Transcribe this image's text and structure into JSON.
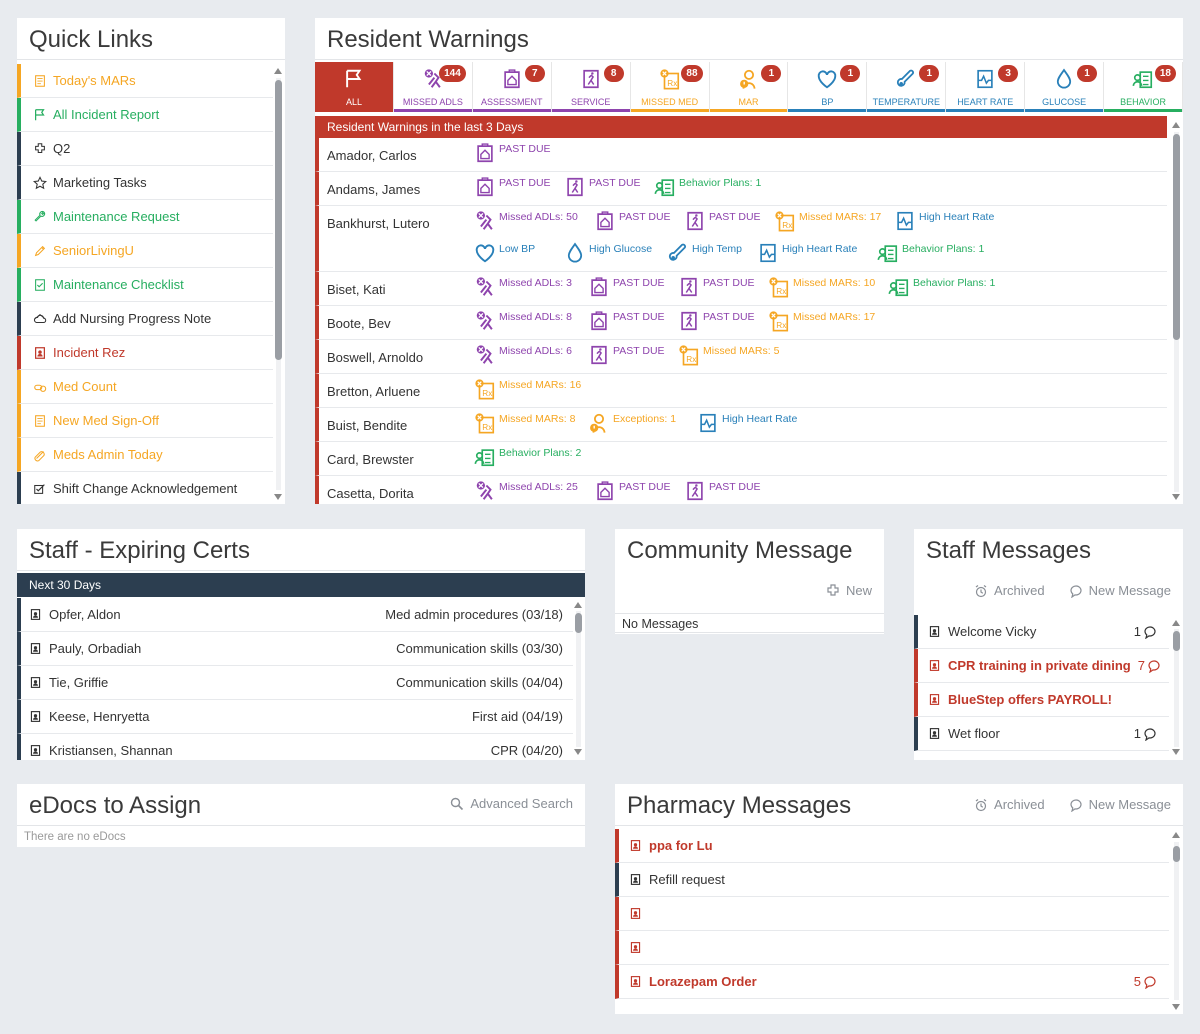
{
  "quick_links": {
    "title": "Quick Links",
    "items": [
      {
        "label": "Today's MARs",
        "icon": "mar-icon",
        "color": "#f5a623"
      },
      {
        "label": "All Incident Report",
        "icon": "flag-icon",
        "color": "#27ae60"
      },
      {
        "label": "Q2",
        "icon": "puzzle-icon",
        "color": "#333333"
      },
      {
        "label": "Marketing Tasks",
        "icon": "star-icon",
        "color": "#333333"
      },
      {
        "label": "Maintenance Request",
        "icon": "wrench-icon",
        "color": "#27ae60"
      },
      {
        "label": "SeniorLivingU",
        "icon": "pencil-icon",
        "color": "#f5a623"
      },
      {
        "label": "Maintenance Checklist",
        "icon": "checklist-icon",
        "color": "#27ae60"
      },
      {
        "label": "Add Nursing Progress Note",
        "icon": "cloud-icon",
        "color": "#333333"
      },
      {
        "label": "Incident Rez",
        "icon": "person-card-icon",
        "color": "#c0392b"
      },
      {
        "label": "Med Count",
        "icon": "pills-icon",
        "color": "#f5a623"
      },
      {
        "label": "New Med Sign-Off",
        "icon": "mar-icon",
        "color": "#f5a623"
      },
      {
        "label": "Meds Admin Today",
        "icon": "pill-icon",
        "color": "#f5a623"
      },
      {
        "label": "Shift Change Acknowledgement",
        "icon": "checkbox-edit-icon",
        "color": "#333333"
      }
    ]
  },
  "resident_warnings": {
    "title": "Resident Warnings",
    "banner": "Resident Warnings in the last 3 Days",
    "tabs": [
      {
        "label": "ALL",
        "badge": "",
        "color": "#c0392b",
        "icon": "flag-icon"
      },
      {
        "label": "MISSED ADLS",
        "badge": "144",
        "color": "#8e44ad",
        "icon": "missed-adl-icon"
      },
      {
        "label": "ASSESSMENT",
        "badge": "7",
        "color": "#8e44ad",
        "icon": "assessment-icon"
      },
      {
        "label": "SERVICE",
        "badge": "8",
        "color": "#8e44ad",
        "icon": "service-icon"
      },
      {
        "label": "MISSED MED",
        "badge": "88",
        "color": "#f5a623",
        "icon": "missed-med-icon"
      },
      {
        "label": "MAR",
        "badge": "1",
        "color": "#f5a623",
        "icon": "mar-exception-icon"
      },
      {
        "label": "BP",
        "badge": "1",
        "color": "#2980b9",
        "icon": "heart-icon"
      },
      {
        "label": "TEMPERATURE",
        "badge": "1",
        "color": "#2980b9",
        "icon": "thermometer-icon"
      },
      {
        "label": "HEART RATE",
        "badge": "3",
        "color": "#2980b9",
        "icon": "heart-rate-icon"
      },
      {
        "label": "GLUCOSE",
        "badge": "1",
        "color": "#2980b9",
        "icon": "drop-icon"
      },
      {
        "label": "BEHAVIOR",
        "badge": "18",
        "color": "#27ae60",
        "icon": "behavior-icon"
      }
    ],
    "rows": [
      {
        "name": "Amador, Carlos",
        "lines": [
          [
            {
              "t": "PAST DUE",
              "k": "assess"
            }
          ]
        ]
      },
      {
        "name": "Andams, James",
        "lines": [
          [
            {
              "t": "PAST DUE",
              "k": "assess"
            },
            {
              "t": "PAST DUE",
              "k": "service"
            },
            {
              "t": "Behavior Plans: 1",
              "k": "behavior"
            }
          ]
        ]
      },
      {
        "name": "Bankhurst, Lutero",
        "lines": [
          [
            {
              "t": "Missed ADLs: 50",
              "k": "adl"
            },
            {
              "t": "PAST DUE",
              "k": "assess"
            },
            {
              "t": "PAST DUE",
              "k": "service"
            },
            {
              "t": "Missed MARs: 17",
              "k": "med"
            },
            {
              "t": "High Heart Rate",
              "k": "hr"
            }
          ],
          [
            {
              "t": "Low BP",
              "k": "bp"
            },
            {
              "t": "High Glucose",
              "k": "glucose"
            },
            {
              "t": "High Temp",
              "k": "temp"
            },
            {
              "t": "High Heart Rate",
              "k": "hr"
            },
            {
              "t": "Behavior Plans: 1",
              "k": "behavior"
            }
          ]
        ]
      },
      {
        "name": "Biset, Kati",
        "lines": [
          [
            {
              "t": "Missed ADLs: 3",
              "k": "adl"
            },
            {
              "t": "PAST DUE",
              "k": "assess"
            },
            {
              "t": "PAST DUE",
              "k": "service"
            },
            {
              "t": "Missed MARs: 10",
              "k": "med"
            },
            {
              "t": "Behavior Plans: 1",
              "k": "behavior"
            }
          ]
        ]
      },
      {
        "name": "Boote, Bev",
        "lines": [
          [
            {
              "t": "Missed ADLs: 8",
              "k": "adl"
            },
            {
              "t": "PAST DUE",
              "k": "assess"
            },
            {
              "t": "PAST DUE",
              "k": "service"
            },
            {
              "t": "Missed MARs: 17",
              "k": "med"
            }
          ]
        ]
      },
      {
        "name": "Boswell, Arnoldo",
        "lines": [
          [
            {
              "t": "Missed ADLs: 6",
              "k": "adl"
            },
            {
              "t": "PAST DUE",
              "k": "service"
            },
            {
              "t": "Missed MARs: 5",
              "k": "med"
            }
          ]
        ]
      },
      {
        "name": "Bretton, Arluene",
        "lines": [
          [
            {
              "t": "Missed MARs: 16",
              "k": "med"
            }
          ]
        ]
      },
      {
        "name": "Buist, Bendite",
        "lines": [
          [
            {
              "t": "Missed MARs: 8",
              "k": "med"
            },
            {
              "t": "Exceptions: 1",
              "k": "exception"
            },
            {
              "t": "High Heart Rate",
              "k": "hr"
            }
          ]
        ]
      },
      {
        "name": "Card, Brewster",
        "lines": [
          [
            {
              "t": "Behavior Plans: 2",
              "k": "behavior"
            }
          ]
        ]
      },
      {
        "name": "Casetta, Dorita",
        "lines": [
          [
            {
              "t": "Missed ADLs: 25",
              "k": "adl"
            },
            {
              "t": "PAST DUE",
              "k": "assess"
            },
            {
              "t": "PAST DUE",
              "k": "service"
            }
          ]
        ]
      }
    ]
  },
  "certs": {
    "title": "Staff - Expiring Certs",
    "header": "Next 30 Days",
    "rows": [
      {
        "name": "Opfer, Aldon",
        "cert": "Med admin procedures (03/18)"
      },
      {
        "name": "Pauly, Orbadiah",
        "cert": "Communication skills (03/30)"
      },
      {
        "name": "Tie, Griffie",
        "cert": "Communication skills (04/04)"
      },
      {
        "name": "Keese, Henryetta",
        "cert": "First aid (04/19)"
      },
      {
        "name": "Kristiansen, Shannan",
        "cert": "CPR (04/20)"
      }
    ]
  },
  "community": {
    "title": "Community Message",
    "new_label": "New",
    "empty": "No Messages"
  },
  "staff_messages": {
    "title": "Staff Messages",
    "archived_label": "Archived",
    "new_message_label": "New Message",
    "rows": [
      {
        "text": "Welcome Vicky",
        "count": "1",
        "color": "#2c3e50",
        "text_color": "#333333",
        "bold": false
      },
      {
        "text": "CPR training in private dining",
        "count": "7",
        "color": "#c0392b",
        "text_color": "#c0392b",
        "bold": true
      },
      {
        "text": "BlueStep offers PAYROLL!",
        "count": "",
        "color": "#c0392b",
        "text_color": "#c0392b",
        "bold": true
      },
      {
        "text": "Wet floor",
        "count": "1",
        "color": "#2c3e50",
        "text_color": "#333333",
        "bold": false
      }
    ]
  },
  "edocs": {
    "title": "eDocs to Assign",
    "search_label": "Advanced Search",
    "empty": "There are no eDocs"
  },
  "pharmacy": {
    "title": "Pharmacy Messages",
    "archived_label": "Archived",
    "new_message_label": "New Message",
    "rows": [
      {
        "text": "ppa for Lu",
        "count": "",
        "color": "#c0392b",
        "text_color": "#c0392b",
        "bold": true
      },
      {
        "text": "Refill request",
        "count": "",
        "color": "#2c3e50",
        "text_color": "#333333",
        "bold": false
      },
      {
        "text": "",
        "count": "",
        "color": "#c0392b",
        "text_color": "#c0392b",
        "bold": true
      },
      {
        "text": "",
        "count": "",
        "color": "#c0392b",
        "text_color": "#c0392b",
        "bold": true
      },
      {
        "text": "Lorazepam Order",
        "count": "5",
        "color": "#c0392b",
        "text_color": "#c0392b",
        "bold": true
      }
    ]
  }
}
